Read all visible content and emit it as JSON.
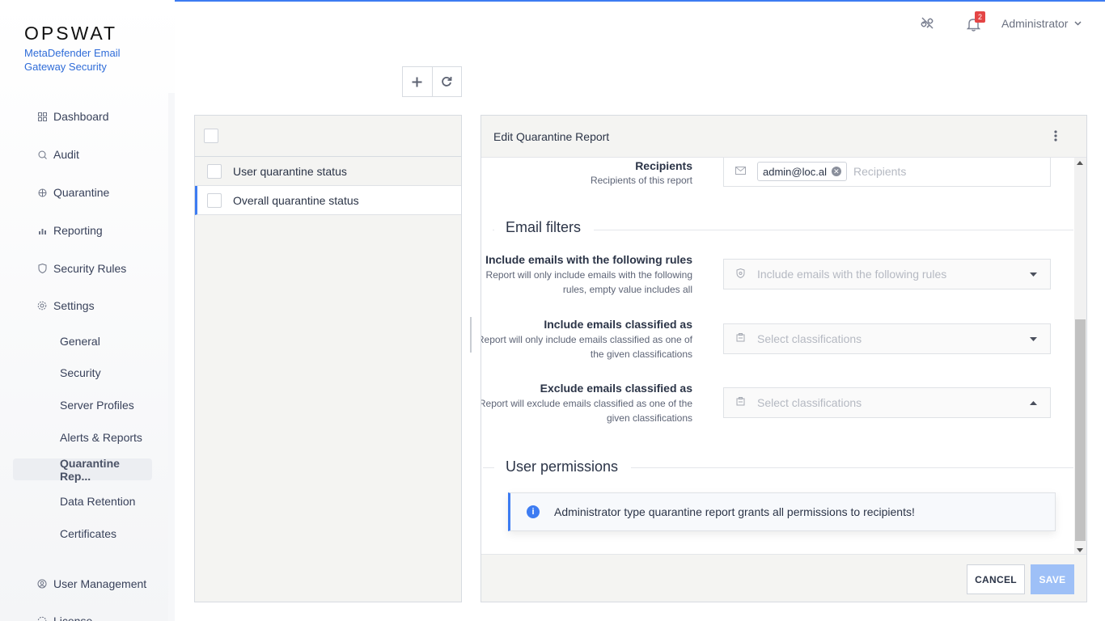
{
  "brand": {
    "logo": "OPSWAT",
    "product": "MetaDefender Email Gateway Security"
  },
  "header": {
    "notification_count": "2",
    "user": "Administrator"
  },
  "sidebar": {
    "items": [
      {
        "label": "Dashboard",
        "icon": "dashboard-icon"
      },
      {
        "label": "Audit",
        "icon": "audit-icon"
      },
      {
        "label": "Quarantine",
        "icon": "quarantine-icon"
      },
      {
        "label": "Reporting",
        "icon": "chart-icon"
      },
      {
        "label": "Security Rules",
        "icon": "shield-icon"
      },
      {
        "label": "Settings",
        "icon": "gear-icon"
      }
    ],
    "settings_children": [
      "General",
      "Security",
      "Server Profiles",
      "Alerts & Reports",
      "Quarantine Rep...",
      "Data Retention",
      "Certificates"
    ],
    "bottom_items": [
      {
        "label": "User Management",
        "icon": "user-icon"
      },
      {
        "label": "License",
        "icon": "license-icon"
      }
    ],
    "active_item": "Quarantine Rep..."
  },
  "reports": [
    {
      "label": "User quarantine status",
      "selected": false
    },
    {
      "label": "Overall quarantine status",
      "selected": true
    }
  ],
  "edit": {
    "title": "Edit Quarantine Report",
    "recipients": {
      "label": "Recipients",
      "help": "Recipients of this report",
      "chip": "admin@loc.al",
      "placeholder": "Recipients"
    },
    "email_filters_title": "Email filters",
    "include_rules": {
      "label": "Include emails with the following rules",
      "help": "Report will only include emails with the following rules, empty value includes all",
      "placeholder": "Include emails with the following rules"
    },
    "include_classified": {
      "label": "Include emails classified as",
      "help": "Report will only include emails classified as one of the given classifications",
      "placeholder": "Select classifications"
    },
    "exclude_classified": {
      "label": "Exclude emails classified as",
      "help": "Report will exclude emails classified as one of the given classifications",
      "placeholder": "Select classifications"
    },
    "user_permissions_title": "User permissions",
    "info_message": "Administrator type quarantine report grants all permissions to recipients!",
    "cancel_label": "CANCEL",
    "save_label": "SAVE"
  },
  "colors": {
    "accent": "#3d7cf2",
    "badge": "#e44545",
    "save_disabled": "#9ec0f7"
  }
}
